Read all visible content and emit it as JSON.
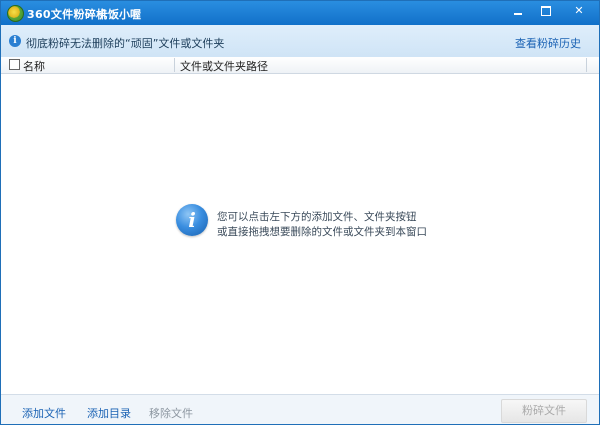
{
  "app": {
    "title": "360文件粉碎机",
    "subtitle": "卡饭小喔"
  },
  "info_bar": {
    "message": "彻底粉碎无法删除的“顽固”文件或文件夹",
    "history_link": "查看粉碎历史"
  },
  "columns": {
    "name": "名称",
    "path": "文件或文件夹路径"
  },
  "empty_hint": {
    "line1": "您可以点击左下方的添加文件、文件夹按钮",
    "line2": "或直接拖拽想要删除的文件或文件夹到本窗口"
  },
  "toolbar": {
    "add_file": "添加文件",
    "add_dir": "添加目录",
    "remove_file": "移除文件",
    "shred": "粉碎文件"
  },
  "colors": {
    "titlebar": "#1170c9",
    "link": "#1a62b4",
    "disabled": "#8d97a1"
  }
}
